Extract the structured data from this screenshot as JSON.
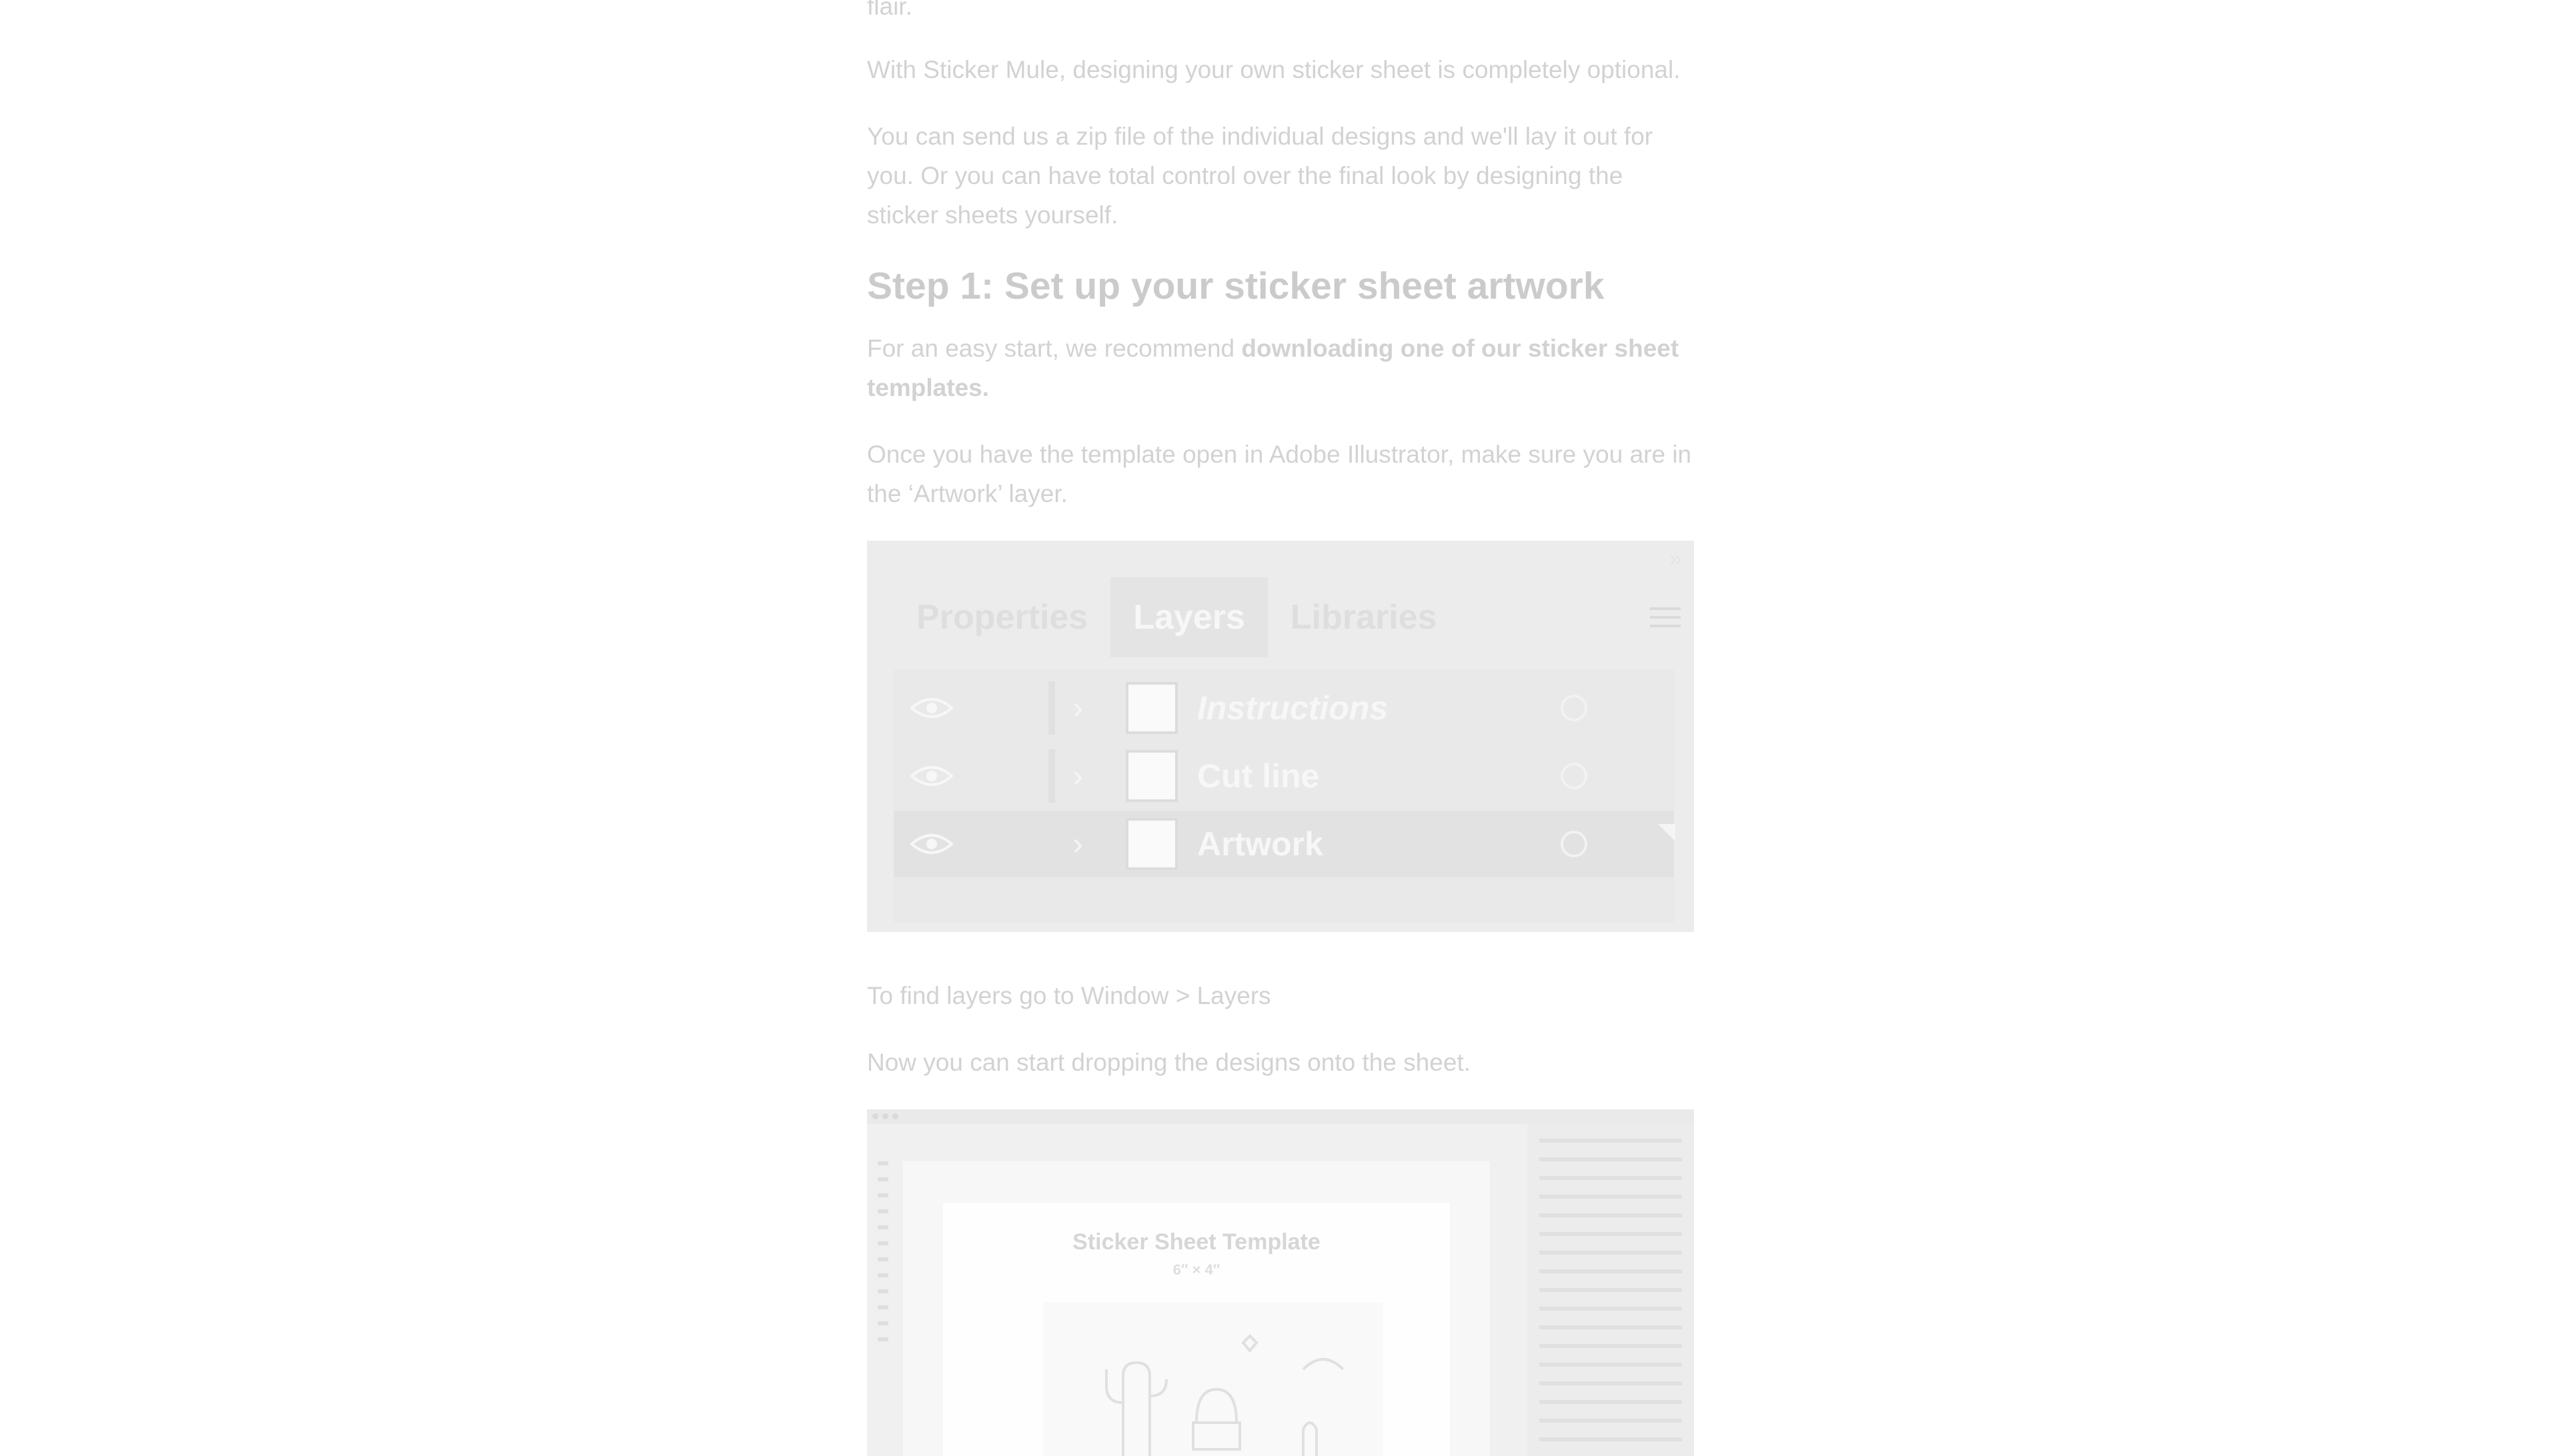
{
  "article": {
    "intro_tail": "flair.",
    "p_optional": "With Sticker Mule, designing your own sticker sheet is completely optional.",
    "p_zip": "You can send us a zip file of the individual designs and we'll lay it out for you. Or you can have total control over the final look by designing the sticker sheets yourself.",
    "step1_heading": "Step 1: Set up your sticker sheet artwork",
    "p_easy_prefix": "For an easy start, we recommend ",
    "p_easy_link": "downloading one of our sticker sheet templates.",
    "p_template": "Once you have the template open in Adobe Illustrator, make sure you are in the ‘Artwork’ layer.",
    "p_find_layers": "To find layers go to Window > Layers",
    "p_drop": "Now you can start dropping the designs onto the sheet."
  },
  "layers_panel": {
    "collapse_glyph": "»",
    "tabs": [
      {
        "label": "Properties",
        "active": false
      },
      {
        "label": "Layers",
        "active": true
      },
      {
        "label": "Libraries",
        "active": false
      }
    ],
    "layers": [
      {
        "name": "Instructions",
        "italic": true,
        "selected": false
      },
      {
        "name": "Cut line",
        "italic": false,
        "selected": false
      },
      {
        "name": "Artwork",
        "italic": false,
        "selected": true
      }
    ],
    "icons": {
      "visibility": "eye-icon",
      "expand": "chevron-right-icon",
      "target": "target-circle-icon",
      "menu": "hamburger-menu-icon"
    }
  },
  "illustrator_shot": {
    "template_title": "Sticker Sheet Template",
    "template_size": "6″ × 4″"
  },
  "colors": {
    "panel_bg": "#ececec",
    "panel_selected_row": "#e2e2e2",
    "body_text": "#d2d2d2",
    "heading_text": "#cbcbcb"
  }
}
